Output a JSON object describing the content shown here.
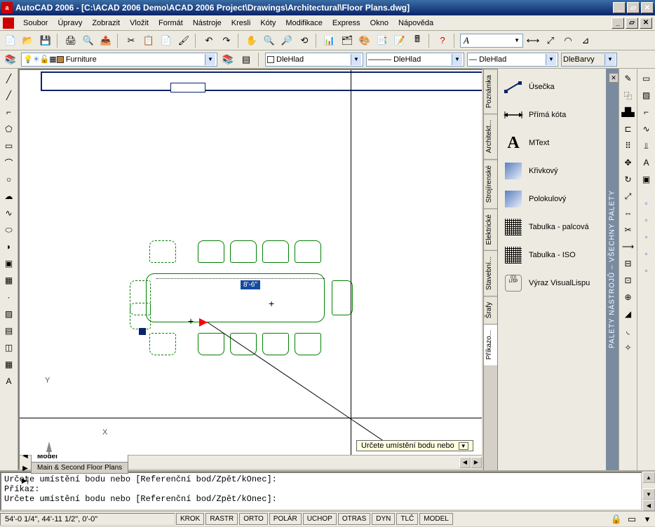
{
  "titlebar": {
    "text": "AutoCAD 2006 - [C:\\ACAD 2006 Demo\\ACAD 2006 Project\\Drawings\\Architectural\\Floor Plans.dwg]"
  },
  "menu": [
    "Soubor",
    "Úpravy",
    "Zobrazit",
    "Vložit",
    "Formát",
    "Nástroje",
    "Kresli",
    "Kóty",
    "Modifikace",
    "Express",
    "Okno",
    "Nápověda"
  ],
  "layer": {
    "current": "Furniture",
    "color_combo": "DleHlad",
    "linetype_combo": "DleHlad",
    "lineweight_combo": "DleHlad",
    "plotstyle_combo": "DleBarvy"
  },
  "textstyle": {
    "symbol": "A"
  },
  "drawing": {
    "dimension_label": "8'-6\"",
    "tooltip": "Určete umístění bodu nebo",
    "ucs_x": "X",
    "ucs_y": "Y"
  },
  "tabs": {
    "nav": [
      "|◀",
      "◀",
      "▶",
      "▶|"
    ],
    "items": [
      "Model",
      "Main & Second Floor Plans"
    ]
  },
  "palette_tabs": [
    "Poznámka",
    "Architekt...",
    "Strojírenské",
    "Elektrické",
    "Stavební...",
    "Šrafy",
    "Příkazo..."
  ],
  "palette_title": "PALETY NÁSTROJŮ – VŠECHNY PALETY",
  "palette_items": [
    {
      "label": "Úsečka",
      "icon": "line"
    },
    {
      "label": "Přímá kóta",
      "icon": "dim"
    },
    {
      "label": "MText",
      "icon": "A"
    },
    {
      "label": "Křivkový",
      "icon": "grad"
    },
    {
      "label": "Polokulový",
      "icon": "grad"
    },
    {
      "label": "Tabulka - palcová",
      "icon": "table"
    },
    {
      "label": "Tabulka - ISO",
      "icon": "table"
    },
    {
      "label": "Výraz VisualLispu",
      "icon": "lisp"
    }
  ],
  "command": {
    "line1": "Určete umístění bodu nebo [Referenční bod/Zpět/kOnec]:",
    "line2": "Příkaz:",
    "line3": "Určete umístění bodu nebo [Referenční bod/Zpět/kOnec]:"
  },
  "status": {
    "coords": "54'-0 1/4\", 44'-11 1/2\", 0'-0\"",
    "buttons": [
      "KROK",
      "RASTR",
      "ORTO",
      "POLÁR",
      "UCHOP",
      "OTRAS",
      "DYN",
      "TLČ",
      "MODEL"
    ]
  }
}
